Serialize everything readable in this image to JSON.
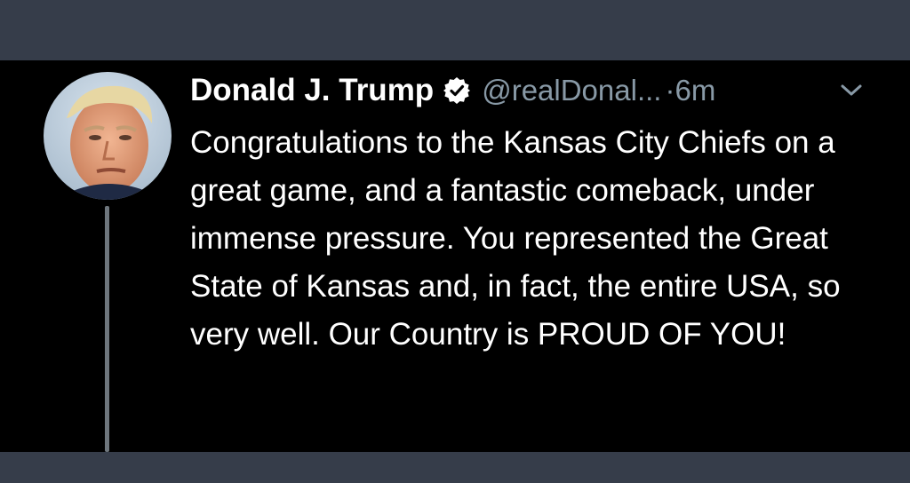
{
  "tweet": {
    "display_name": "Donald J. Trump",
    "handle": "@realDonal...",
    "separator": "·",
    "timestamp": "6m",
    "text": "Congratulations to the Kansas City Chiefs on a great game, and a fantastic comeback, under immense pressure. You represented the Great State of Kansas and, in fact, the entire USA, so very well. Our Country is PROUD OF YOU!",
    "icons": {
      "verified": "verified-badge-icon",
      "menu": "chevron-down-icon"
    }
  },
  "colors": {
    "background": "#000000",
    "frame": "#363d4a",
    "primary_text": "#ffffff",
    "secondary_text": "#8899a6",
    "thread_line": "#6e767d"
  }
}
